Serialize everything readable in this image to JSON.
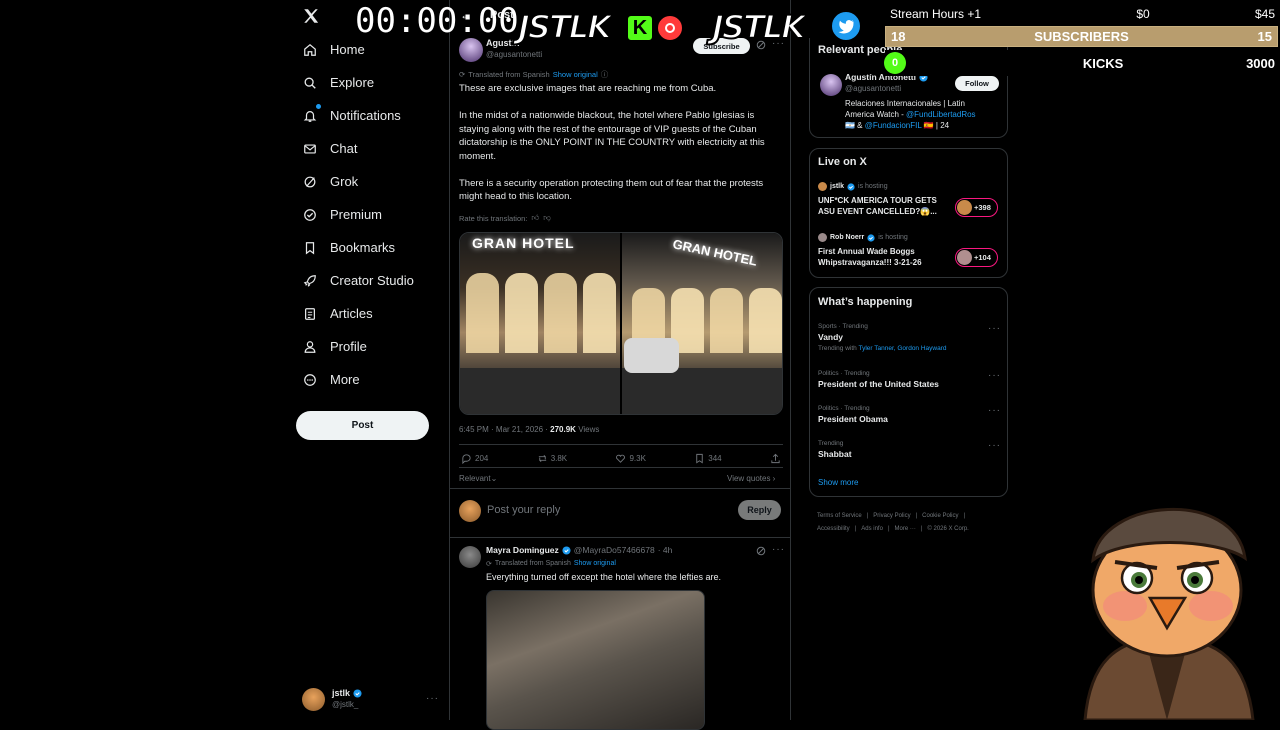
{
  "nav": {
    "items": [
      {
        "label": "Home",
        "icon": "home-icon"
      },
      {
        "label": "Explore",
        "icon": "search-icon"
      },
      {
        "label": "Notifications",
        "icon": "bell-icon"
      },
      {
        "label": "Chat",
        "icon": "mail-icon"
      },
      {
        "label": "Grok",
        "icon": "grok-icon"
      },
      {
        "label": "Premium",
        "icon": "premium-icon"
      },
      {
        "label": "Bookmarks",
        "icon": "bookmark-icon"
      },
      {
        "label": "Creator Studio",
        "icon": "rocket-icon"
      },
      {
        "label": "Articles",
        "icon": "article-icon"
      },
      {
        "label": "Profile",
        "icon": "person-icon"
      },
      {
        "label": "More",
        "icon": "more-circle-icon"
      }
    ],
    "post_label": "Post",
    "account": {
      "name": "jstlk",
      "handle": "@jstlk_"
    }
  },
  "header": {
    "title": "Post"
  },
  "tweet": {
    "author": "Agustín",
    "handle": "@agusantonetti",
    "subscribe": "Subscribe",
    "translated": "Translated from Spanish",
    "show_original": "Show original",
    "para1": "These are exclusive images that are reaching me from Cuba.",
    "para2": "In the midst of a nationwide blackout, the hotel where Pablo Iglesias is staying along with the rest of the entourage of VIP guests of the Cuban dictatorship is the ONLY POINT IN THE COUNTRY with electricity at this moment.",
    "para3": "There is a security operation protecting them out of fear that the protests might head to this location.",
    "rate": "Rate this translation:",
    "image_sign_left": "GRAN HOTEL",
    "image_sign_right": "GRAN HOTEL",
    "timestamp": "6:45 PM · Mar 21, 2026 · ",
    "views_count": "270.9K",
    "views_label": "Views",
    "replies": "204",
    "reposts": "3.8K",
    "likes": "9.3K",
    "bookmarks": "344",
    "sort_label": "Relevant",
    "view_quotes": "View quotes"
  },
  "reply_box": {
    "placeholder": "Post your reply",
    "button": "Reply"
  },
  "reply": {
    "author": "Mayra Dominguez",
    "handle": "@MayraDo57466678",
    "time": "· 4h",
    "translated": "Translated from Spanish",
    "show_original": "Show original",
    "text": "Everything turned off except the hotel where the lefties are."
  },
  "relevant": {
    "title": "Relevant people",
    "name": "Agustín Antonetti",
    "handle": "@agusantonetti",
    "follow": "Follow",
    "bio_line1": "Relaciones Internacionales | Latin",
    "bio_line2_pre": "America Watch - ",
    "bio_link1": "@FundLibertadRos",
    "bio_line3_pre": "🇦🇷 & ",
    "bio_link2": "@FundacionFIL",
    "bio_line3_post": " 🇪🇸 | 24"
  },
  "live": {
    "title": "Live on X",
    "items": [
      {
        "host": "jstlk",
        "status": "is hosting",
        "title1": "UNF*CK AMERICA TOUR GETS",
        "title2": "ASU EVENT CANCELLED?😱...",
        "count": "+398"
      },
      {
        "host": "Rob Noerr",
        "status": "is hosting",
        "title1": "First Annual Wade Boggs",
        "title2": "Whipstravaganza!!! 3-21-26",
        "count": "+104"
      }
    ]
  },
  "happening": {
    "title": "What’s happening",
    "items": [
      {
        "meta": "Sports · Trending",
        "topic": "Vandy",
        "extra_pre": "Trending with ",
        "extra_link": "Tyler Tanner, Gordon Hayward"
      },
      {
        "meta": "Politics · Trending",
        "topic": "President of the United States"
      },
      {
        "meta": "Politics · Trending",
        "topic": "President Obama"
      },
      {
        "meta": "Trending",
        "topic": "Shabbat"
      }
    ],
    "show_more": "Show more"
  },
  "footer": {
    "line1": [
      "Terms of Service",
      "|",
      "Privacy Policy",
      "|",
      "Cookie Policy",
      "|"
    ],
    "line2": [
      "Accessibility",
      "|",
      "Ads info",
      "|",
      "More ···",
      "|",
      "© 2026 X Corp."
    ]
  },
  "overlay": {
    "timer": "00:00:00",
    "logo1": "JSTLK",
    "logo2": "JSTLK",
    "stream_hours": "Stream Hours +1",
    "stream_money": "$0",
    "stream_goal": "$45",
    "subs_left": "18",
    "subs_label": "SUBSCRIBERS",
    "subs_right": "15",
    "kicks_count": "0",
    "kicks_label": "KICKS",
    "kicks_goal": "3000"
  },
  "colors": {
    "accent": "#1d9bf0",
    "subs_bar": "#b89d6e",
    "kick_green": "#53fc18",
    "live_ring": "#f91880"
  }
}
